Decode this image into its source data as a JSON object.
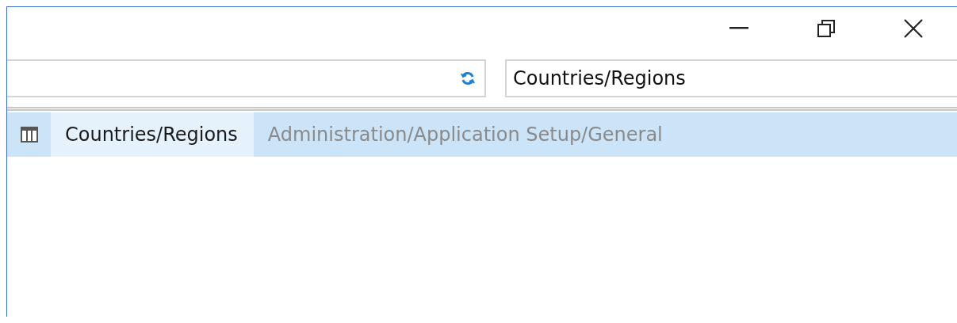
{
  "window": {
    "controls": [
      {
        "kind": "minimize"
      },
      {
        "kind": "restore"
      },
      {
        "kind": "close"
      }
    ]
  },
  "toolbar": {
    "search": {
      "value": "Countries/Regions"
    }
  },
  "results": [
    {
      "name": "Countries/Regions",
      "path": "Administration/Application Setup/General",
      "selected": true
    }
  ]
}
